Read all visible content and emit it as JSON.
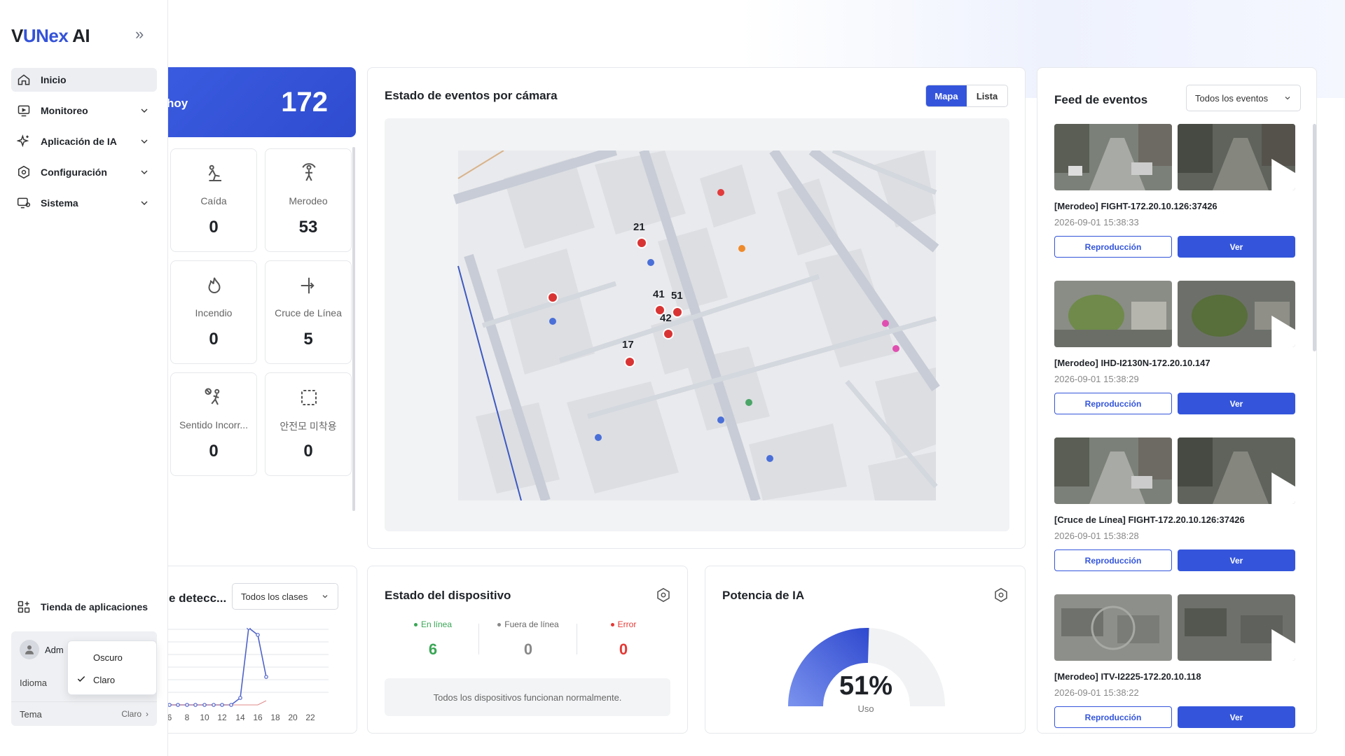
{
  "app": {
    "logo_prefix": "V",
    "logo_brand": "UNex",
    "logo_suffix": " AI"
  },
  "sidebar": {
    "items": [
      {
        "label": "Inicio",
        "icon": "home-icon",
        "active": true
      },
      {
        "label": "Monitoreo",
        "icon": "monitor-icon"
      },
      {
        "label": "Aplicación de IA",
        "icon": "sparkle-icon"
      },
      {
        "label": "Configuración",
        "icon": "gear-icon"
      },
      {
        "label": "Sistema",
        "icon": "system-icon"
      }
    ],
    "app_store": "Tienda de aplicaciones",
    "user": "Adm",
    "language_label": "Idioma",
    "theme_label": "Tema",
    "theme_value": "Claro",
    "theme_menu": {
      "dark": "Oscuro",
      "light": "Claro"
    }
  },
  "today": {
    "label": "hoy",
    "value": "172"
  },
  "stats": [
    {
      "label": "Caída",
      "value": "0",
      "icon": "fall-icon"
    },
    {
      "label": "Merodeo",
      "value": "53",
      "icon": "loitering-icon"
    },
    {
      "label": "Incendio",
      "value": "0",
      "icon": "fire-icon"
    },
    {
      "label": "Cruce de Línea",
      "value": "5",
      "icon": "line-cross-icon"
    },
    {
      "label": "Sentido Incorr...",
      "value": "0",
      "icon": "wrong-way-icon"
    },
    {
      "label": "안전모 미착용",
      "value": "0",
      "icon": "helmet-frame-icon"
    }
  ],
  "map": {
    "title": "Estado de eventos por cámara",
    "toggle": {
      "map": "Mapa",
      "list": "Lista"
    },
    "markers": [
      "21",
      "41",
      "51",
      "42",
      "17"
    ]
  },
  "feed": {
    "title": "Feed de eventos",
    "filter": "Todos los eventos",
    "replay_label": "Reproducción",
    "view_label": "Ver",
    "items": [
      {
        "title": "[Merodeo] FIGHT-172.20.10.126:37426",
        "time": "2026-09-01 15:38:33"
      },
      {
        "title": "[Merodeo] IHD-I2130N-172.20.10.147",
        "time": "2026-09-01 15:38:29"
      },
      {
        "title": "[Cruce de Línea] FIGHT-172.20.10.126:37426",
        "time": "2026-09-01 15:38:28"
      },
      {
        "title": "[Merodeo] ITV-I2225-172.20.10.118",
        "time": "2026-09-01 15:38:22"
      }
    ]
  },
  "detection": {
    "title": "e detecc...",
    "filter": "Todos los clases",
    "x_ticks": [
      "6",
      "8",
      "10",
      "12",
      "14",
      "16",
      "18",
      "20",
      "22"
    ]
  },
  "device": {
    "title": "Estado del dispositivo",
    "online_label": "En línea",
    "online": "6",
    "offline_label": "Fuera de línea",
    "offline": "0",
    "error_label": "Error",
    "error": "0",
    "message": "Todos los dispositivos funcionan normalmente.",
    "colors": {
      "online": "#3aa655",
      "offline": "#888888",
      "error": "#e53935"
    }
  },
  "ai_power": {
    "title": "Potencia de IA",
    "percent": 51,
    "percent_label": "51%",
    "sub": "Uso"
  }
}
